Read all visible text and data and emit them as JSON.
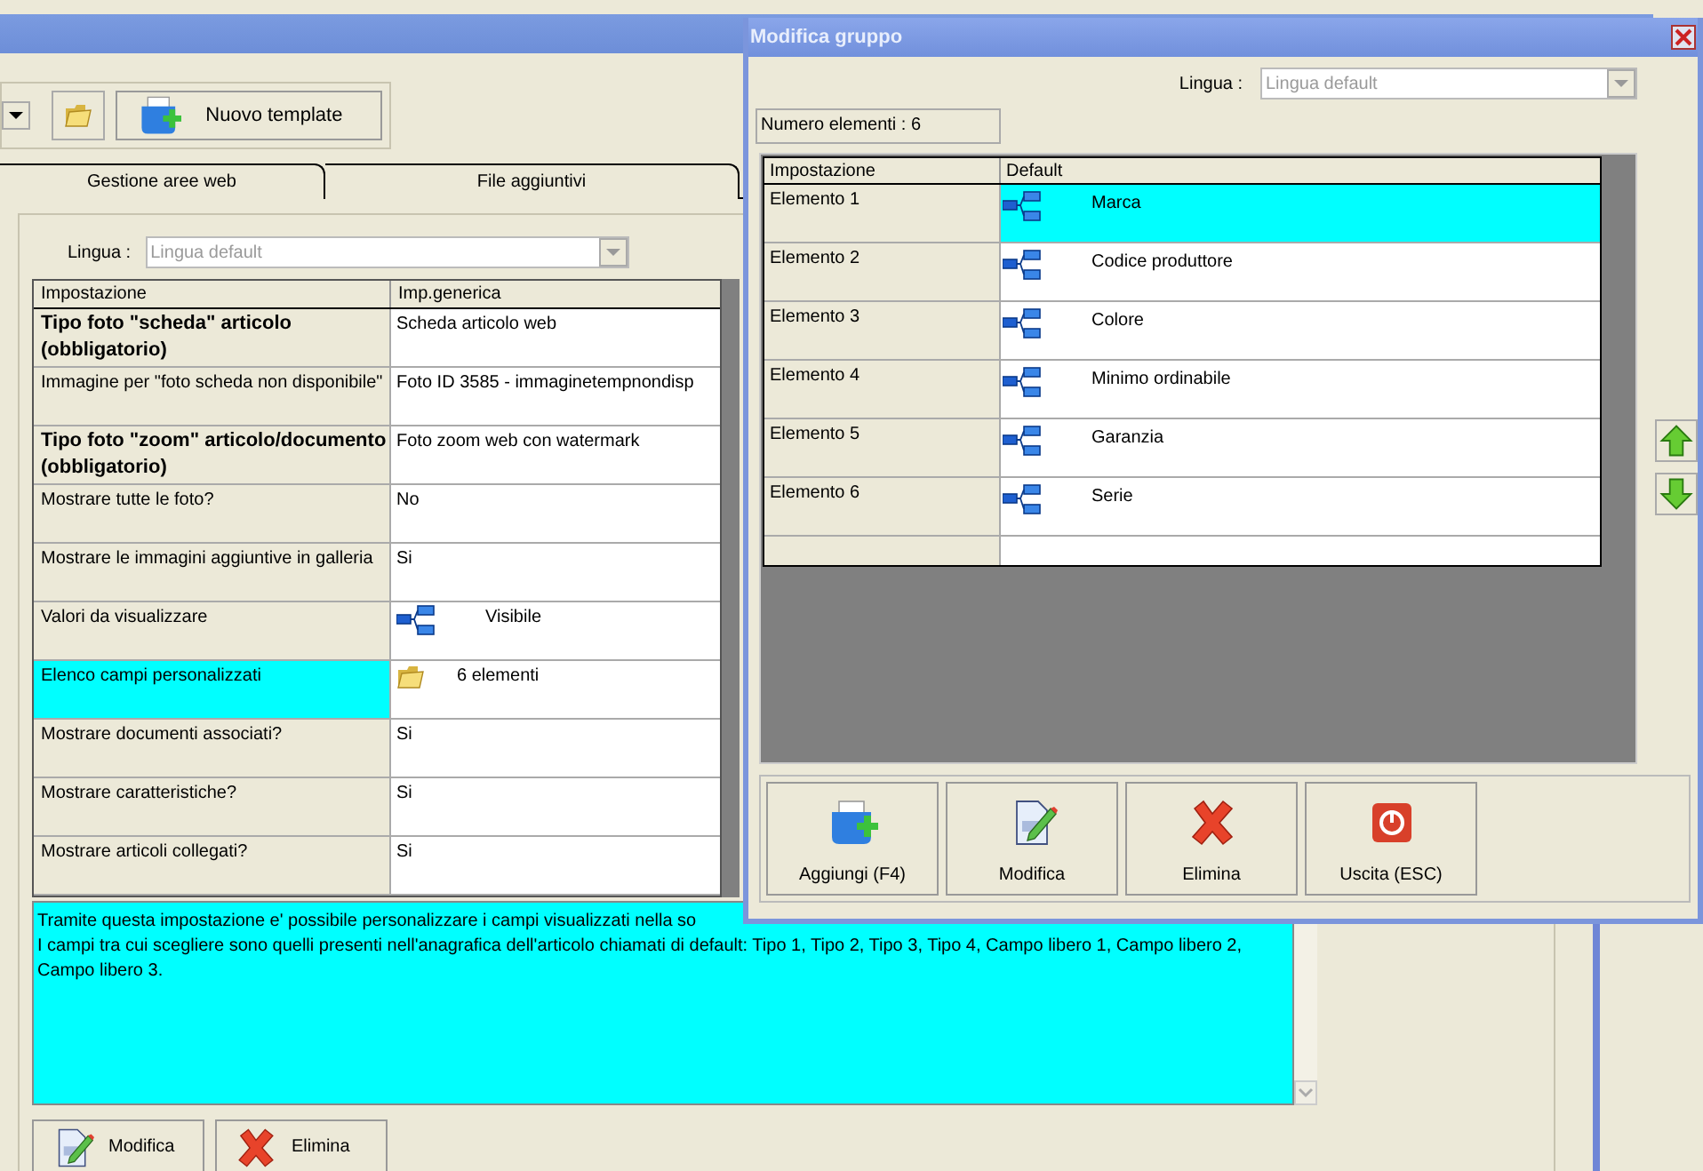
{
  "toolbar": {
    "template_button": "Nuovo template"
  },
  "tabs": [
    {
      "label": "Gestione aree web",
      "selected": false
    },
    {
      "label": "File aggiuntivi",
      "selected": false
    }
  ],
  "settings": {
    "language_label": "Lingua :",
    "language_placeholder": "Lingua default",
    "columns": [
      "Impostazione",
      "Imp.generica"
    ],
    "rows": [
      {
        "name": "Tipo foto \"scheda\" articolo (obbligatorio)",
        "value": "Scheda articolo web",
        "bold": true,
        "selected": false,
        "kind": "text"
      },
      {
        "name": "Immagine per \"foto scheda non disponibile\"",
        "value": "Foto ID 3585 - immaginetempnondisp",
        "bold": false,
        "selected": false,
        "kind": "text"
      },
      {
        "name": "Tipo foto \"zoom\" articolo/documento (obbligatorio)",
        "value": "Foto zoom web con watermark",
        "bold": true,
        "selected": false,
        "kind": "text"
      },
      {
        "name": "Mostrare tutte le foto?",
        "value": "No",
        "bold": false,
        "selected": false,
        "kind": "text"
      },
      {
        "name": "Mostrare le immagini aggiuntive in galleria",
        "value": "Si",
        "bold": false,
        "selected": false,
        "kind": "text"
      },
      {
        "name": "Valori da visualizzare",
        "value": "Visibile",
        "bold": false,
        "selected": false,
        "kind": "tree"
      },
      {
        "name": "Elenco campi personalizzati",
        "value": "6 elementi",
        "bold": false,
        "selected": true,
        "kind": "folder"
      },
      {
        "name": "Mostrare documenti associati?",
        "value": "Si",
        "bold": false,
        "selected": false,
        "kind": "text"
      },
      {
        "name": "Mostrare caratteristiche?",
        "value": "Si",
        "bold": false,
        "selected": false,
        "kind": "text"
      },
      {
        "name": "Mostrare articoli collegati?",
        "value": "Si",
        "bold": false,
        "selected": false,
        "kind": "text"
      }
    ]
  },
  "description": [
    "Tramite questa impostazione e' possibile personalizzare i campi visualizzati nella so",
    "I campi tra cui scegliere sono quelli presenti nell'anagrafica dell'articolo chiamati di default: Tipo 1, Tipo 2, Tipo 3, Tipo 4, Campo libero 1, Campo libero 2, Campo libero 3."
  ],
  "buttons": [
    {
      "label": "Modifica",
      "kind": "edit"
    },
    {
      "label": "Elimina",
      "kind": "delete"
    }
  ],
  "dialog": {
    "title": "Modifica gruppo",
    "language_label": "Lingua :",
    "language_placeholder": "Lingua default",
    "count": "Numero elementi : 6",
    "columns": [
      "Impostazione",
      "Default"
    ],
    "rows": [
      {
        "name": "Elemento 1",
        "value": "Marca",
        "selected": true
      },
      {
        "name": "Elemento 2",
        "value": "Codice produttore",
        "selected": false
      },
      {
        "name": "Elemento 3",
        "value": "Colore",
        "selected": false
      },
      {
        "name": "Elemento 4",
        "value": "Minimo ordinabile",
        "selected": false
      },
      {
        "name": "Elemento 5",
        "value": "Garanzia",
        "selected": false
      },
      {
        "name": "Elemento 6",
        "value": "Serie",
        "selected": false
      }
    ],
    "buttons": [
      {
        "label": "Aggiungi (F4)",
        "kind": "add"
      },
      {
        "label": "Modifica",
        "kind": "edit"
      },
      {
        "label": "Elimina",
        "kind": "delete"
      },
      {
        "label": "Uscita (ESC)",
        "kind": "exit"
      }
    ]
  }
}
